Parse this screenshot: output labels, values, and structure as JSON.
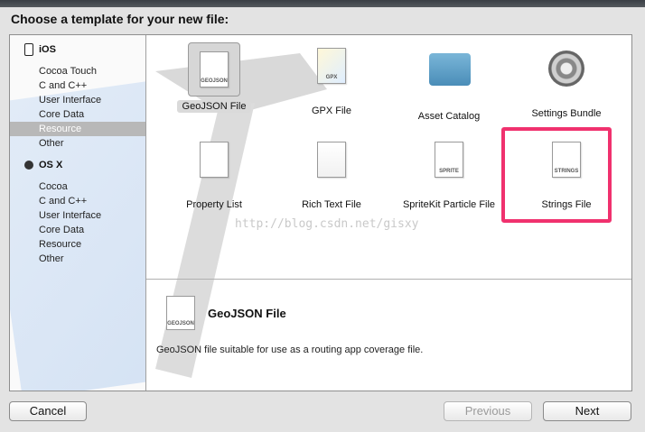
{
  "dialog": {
    "title": "Choose a template for your new file:"
  },
  "sidebar": {
    "groups": [
      {
        "label": "iOS",
        "items": [
          "Cocoa Touch",
          "C and C++",
          "User Interface",
          "Core Data",
          "Resource",
          "Other"
        ]
      },
      {
        "label": "OS X",
        "items": [
          "Cocoa",
          "C and C++",
          "User Interface",
          "Core Data",
          "Resource",
          "Other"
        ]
      }
    ],
    "selected": "iOS/Resource"
  },
  "templates": [
    {
      "label": "GeoJSON File",
      "icon": "geojson-file-icon",
      "tag": "GEOJSON",
      "selected": true
    },
    {
      "label": "GPX File",
      "icon": "gpx-file-icon",
      "tag": "GPX"
    },
    {
      "label": "Asset Catalog",
      "icon": "folder-icon"
    },
    {
      "label": "Settings Bundle",
      "icon": "gear-icon"
    },
    {
      "label": "Property List",
      "icon": "plist-file-icon"
    },
    {
      "label": "Rich Text File",
      "icon": "rtf-file-icon"
    },
    {
      "label": "SpriteKit Particle File",
      "icon": "sprite-file-icon",
      "tag": "SPRITE"
    },
    {
      "label": "Strings File",
      "icon": "strings-file-icon",
      "tag": "STRINGS"
    }
  ],
  "detail": {
    "title": "GeoJSON File",
    "description": "GeoJSON file suitable for use as a routing app coverage file.",
    "icon_tag": "GEOJSON"
  },
  "watermark": "http://blog.csdn.net/gisxy",
  "buttons": {
    "cancel": "Cancel",
    "previous": "Previous",
    "next": "Next"
  },
  "colors": {
    "highlight": "#f0316e",
    "selection": "#b8b8b8"
  }
}
